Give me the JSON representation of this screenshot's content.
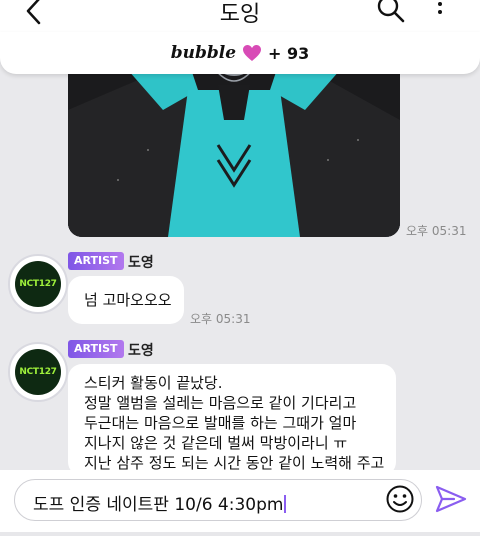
{
  "header": {
    "title": "도잉",
    "back_icon": "chevron-left-icon",
    "search_icon": "search-icon",
    "more_icon": "more-vertical-icon"
  },
  "bubble_bar": {
    "logo": "bubble",
    "heart_color": "#d84bb6",
    "count": "+ 93"
  },
  "messages": [
    {
      "type": "image",
      "time": "오후 05:31"
    },
    {
      "type": "text",
      "badge": "ARTIST",
      "author": "도영",
      "avatar_text": "NCT127",
      "text": "넘 고마오오오",
      "time": "오후 05:31"
    },
    {
      "type": "text",
      "badge": "ARTIST",
      "author": "도영",
      "avatar_text": "NCT127",
      "lines": [
        "스티커 활동이 끝났당.",
        "정말 앨범을 설레는 마음으로 같이 기다리고",
        "두근대는 마음으로 발매를 하는 그때가 얼마",
        "지나지 않은 것 같은데 벌써 막방이라니 ㅠ",
        "지난 삼주 정도 되는 시간 동안 같이 노력해 주고"
      ]
    }
  ],
  "composer": {
    "value": "도프 인증 네이트판 10/6 4:30pm",
    "emoji_icon": "smiley-icon",
    "send_icon": "send-icon"
  },
  "colors": {
    "badge": "#8a5df0",
    "background": "#e9e9ec",
    "avatar_bg": "#0e2912",
    "avatar_text": "#9ef03b"
  }
}
